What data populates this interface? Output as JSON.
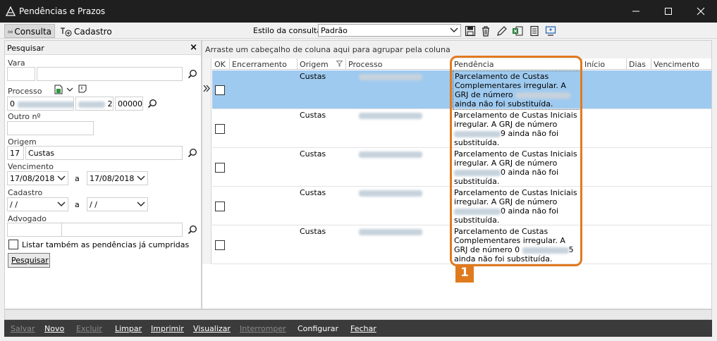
{
  "window": {
    "title": "Pendências e Prazos"
  },
  "tabs": [
    {
      "label": "Consulta"
    },
    {
      "label": "Cadastro"
    }
  ],
  "estilo": {
    "label": "Estilo da consulta",
    "value": "Padrão"
  },
  "search_panel": {
    "title": "Pesquisar",
    "vara_label": "Vara",
    "processo_label": "Processo",
    "processo_value_1": "0",
    "processo_value_2": "2",
    "processo_value_3": "00000",
    "outro_label": "Outro nº",
    "origem_label": "Origem",
    "origem_code": "17",
    "origem_name": "Custas",
    "vencimento_label": "Vencimento",
    "venc_from": "17/08/2018",
    "venc_to": "17/08/2018",
    "a_label": "a",
    "cadastro_label": "Cadastro",
    "cad_from": " / /",
    "cad_to": " / /",
    "advogado_label": "Advogado",
    "cumpridas_label": "Listar também as pendências já cumpridas",
    "pesquisar_button": "Pesquisar"
  },
  "grid": {
    "group_hint": "Arraste um cabeçalho de coluna aqui para agrupar pela coluna",
    "columns": [
      "OK",
      "Encerramento",
      "Origem",
      "Processo",
      "Pendência",
      "Início",
      "Dias",
      "Vencimento"
    ],
    "rows": [
      {
        "origem": "Custas",
        "pend_a": "Parcelamento de Custas Complementares irregular. A GRJ de número",
        "pend_b": "ainda não foi substituída.",
        "selected": true
      },
      {
        "origem": "Custas",
        "pend_a": "Parcelamento de Custas Iniciais irregular. A GRJ de número",
        "pend_b": "9 ainda não foi substituída.",
        "selected": false
      },
      {
        "origem": "Custas",
        "pend_a": "Parcelamento de Custas Iniciais irregular. A GRJ de número",
        "pend_b": "0 ainda não foi substituída.",
        "selected": false
      },
      {
        "origem": "Custas",
        "pend_a": "Parcelamento de Custas Iniciais irregular. A GRJ de número",
        "pend_b": "0 ainda não foi substituída.",
        "selected": false
      },
      {
        "origem": "Custas",
        "pend_a": "Parcelamento de Custas Complementares irregular. A GRJ de número 0",
        "pend_b": "5 ainda não foi substituída.",
        "selected": false
      }
    ]
  },
  "callout": {
    "number": "1",
    "color": "#e07a1f"
  },
  "bottom_actions": [
    {
      "label": "Salvar",
      "enabled": false
    },
    {
      "label": "Novo",
      "enabled": true
    },
    {
      "label": "Excluir",
      "enabled": false
    },
    {
      "label": "Limpar",
      "enabled": true
    },
    {
      "label": "Imprimir",
      "enabled": true
    },
    {
      "label": "Visualizar",
      "enabled": true
    },
    {
      "label": "Interromper",
      "enabled": false
    },
    {
      "label": "Configurar",
      "enabled": true
    },
    {
      "label": "Fechar",
      "enabled": true
    }
  ]
}
